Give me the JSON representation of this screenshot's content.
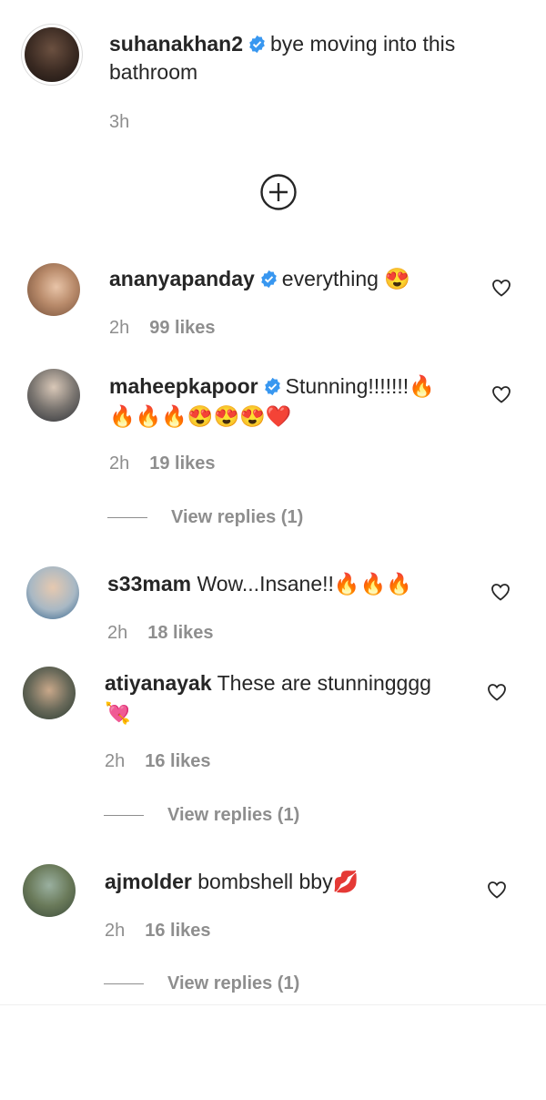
{
  "post": {
    "username": "suhanakhan2",
    "caption": "bye moving into this",
    "caption_line2": "bathroom",
    "time": "3h"
  },
  "comments": [
    {
      "username": "ananyapanday",
      "verified": true,
      "text": "everything 😍",
      "time": "2h",
      "likes": "99 likes"
    },
    {
      "username": "maheepkapoor",
      "verified": true,
      "text": "Stunning!!!!!!!🔥",
      "text_line2": "🔥🔥🔥😍😍😍❤️",
      "time": "2h",
      "likes": "19 likes",
      "replies": "View replies (1)"
    },
    {
      "username": "s33mam",
      "verified": false,
      "text": "Wow...Insane!!🔥🔥🔥",
      "time": "2h",
      "likes": "18 likes"
    },
    {
      "username": "atiyanayak",
      "verified": false,
      "text": "These are stunningggg",
      "text_line2": "💘",
      "time": "2h",
      "likes": "16 likes",
      "replies": "View replies (1)"
    },
    {
      "username": "ajmolder",
      "verified": false,
      "text": "bombshell bby💋",
      "time": "2h",
      "likes": "16 likes",
      "replies": "View replies (1)"
    }
  ],
  "icons": {
    "verified": "verified-badge-icon",
    "like": "heart-outline-icon",
    "load_more": "plus-circle-icon"
  },
  "colors": {
    "verified": "#3897f0",
    "secondary_text": "#8e8e8e",
    "primary_text": "#262626"
  }
}
